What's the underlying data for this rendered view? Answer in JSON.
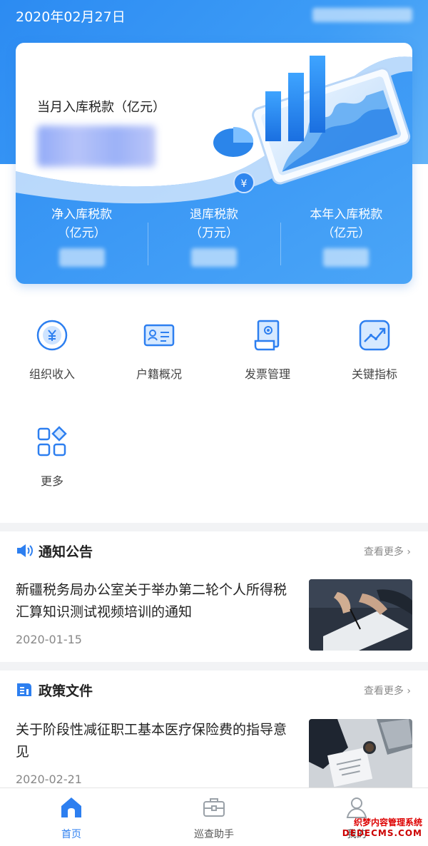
{
  "header": {
    "date": "2020年02月27日"
  },
  "card": {
    "title": "当月入库税款（亿元）",
    "stats": [
      {
        "label": "净入库税款",
        "unit": "（亿元）"
      },
      {
        "label": "退库税款",
        "unit": "（万元）"
      },
      {
        "label": "本年入库税款",
        "unit": "（亿元）"
      }
    ],
    "coin_symbol": "¥"
  },
  "quick": [
    {
      "label": "组织收入",
      "icon": "yuan-coin-icon"
    },
    {
      "label": "户籍概况",
      "icon": "id-card-icon"
    },
    {
      "label": "发票管理",
      "icon": "invoice-icon"
    },
    {
      "label": "关键指标",
      "icon": "trend-chart-icon"
    },
    {
      "label": "更多",
      "icon": "grid-more-icon"
    }
  ],
  "notices": {
    "title": "通知公告",
    "more": "查看更多",
    "item": {
      "title": "新疆税务局办公室关于举办第二轮个人所得税汇算知识测试视频培训的通知",
      "date": "2020-01-15"
    }
  },
  "policies": {
    "title": "政策文件",
    "more": "查看更多",
    "item": {
      "title": "关于阶段性减征职工基本医疗保险费的指导意见",
      "date": "2020-02-21"
    }
  },
  "tabbar": [
    {
      "label": "首页",
      "icon": "home-icon",
      "active": true
    },
    {
      "label": "巡查助手",
      "icon": "toolbox-icon",
      "active": false
    },
    {
      "label": "我的",
      "icon": "user-icon",
      "active": false
    }
  ],
  "watermark": {
    "line1": "织梦内容管理系统",
    "line2": "DEDECMS.COM"
  },
  "colors": {
    "primary": "#2d7ff0",
    "band": "#3d9cf6"
  }
}
